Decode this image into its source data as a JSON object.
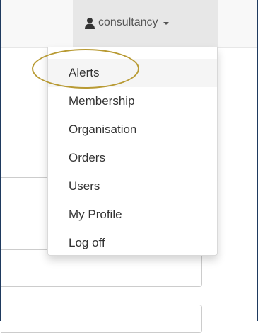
{
  "navbar": {
    "user_menu": {
      "icon": "user-icon",
      "username": "consultancy",
      "toggle_icon": "caret-down-icon"
    }
  },
  "dropdown": {
    "items": [
      {
        "label": "Alerts",
        "highlighted": true
      },
      {
        "label": "Membership"
      },
      {
        "label": "Organisation"
      },
      {
        "label": "Orders"
      },
      {
        "label": "Users"
      },
      {
        "label": "My Profile"
      },
      {
        "label": "Log off"
      }
    ]
  },
  "colors": {
    "annotation": "#b89a33",
    "frame": "#1f3a5f",
    "text": "#333333",
    "toggle_background": "#e7e7e7"
  }
}
